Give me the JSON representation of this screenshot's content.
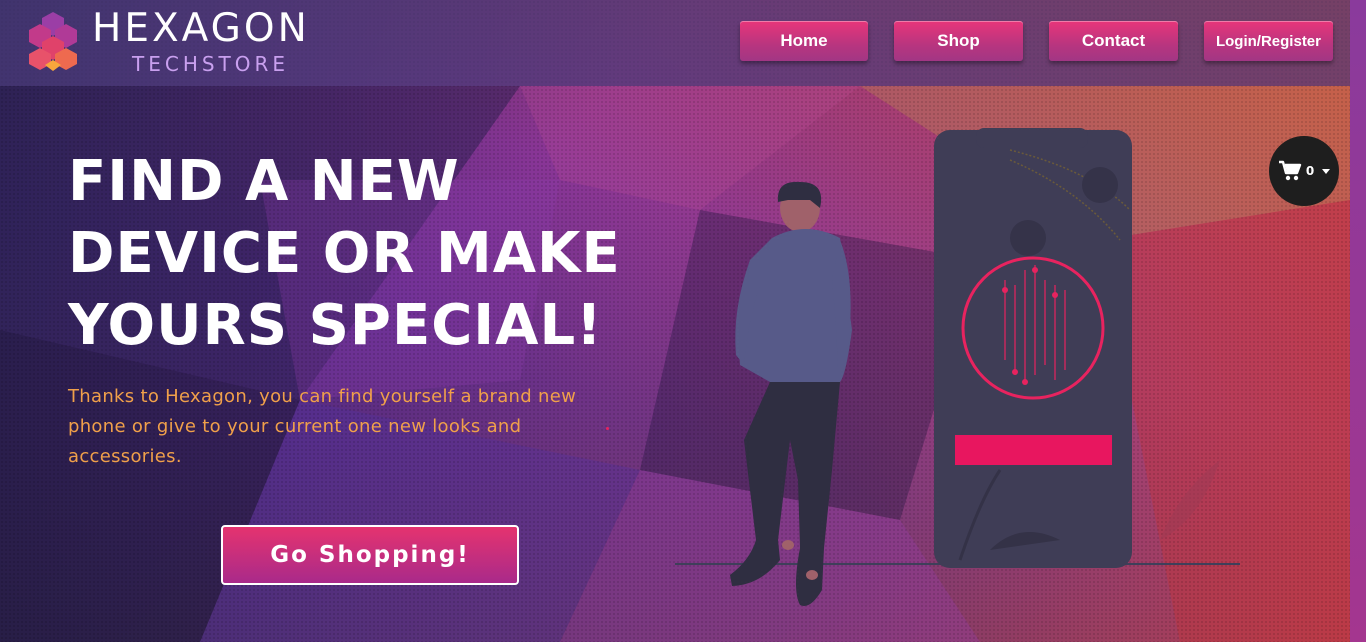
{
  "brand": {
    "name": "HEXAGON",
    "subtitle": "TECHSTORE"
  },
  "nav": {
    "home": "Home",
    "shop": "Shop",
    "contact": "Contact",
    "login": "Login/Register"
  },
  "cart": {
    "count": "0",
    "icon": "shopping-cart-icon"
  },
  "hero": {
    "headline_line1": "FIND A NEW",
    "headline_line2": "DEVICE OR MAKE",
    "headline_line3": "YOURS SPECIAL!",
    "subtext": "Thanks to Hexagon, you can find yourself a brand new phone or give to your current one new looks and accessories.",
    "cta": "Go Shopping!"
  },
  "colors": {
    "accent": "#e8235f",
    "button_top": "#e8357a",
    "button_bottom": "#a23684",
    "subtext": "#f0a04a",
    "brand_sub": "#c9a0ef"
  }
}
